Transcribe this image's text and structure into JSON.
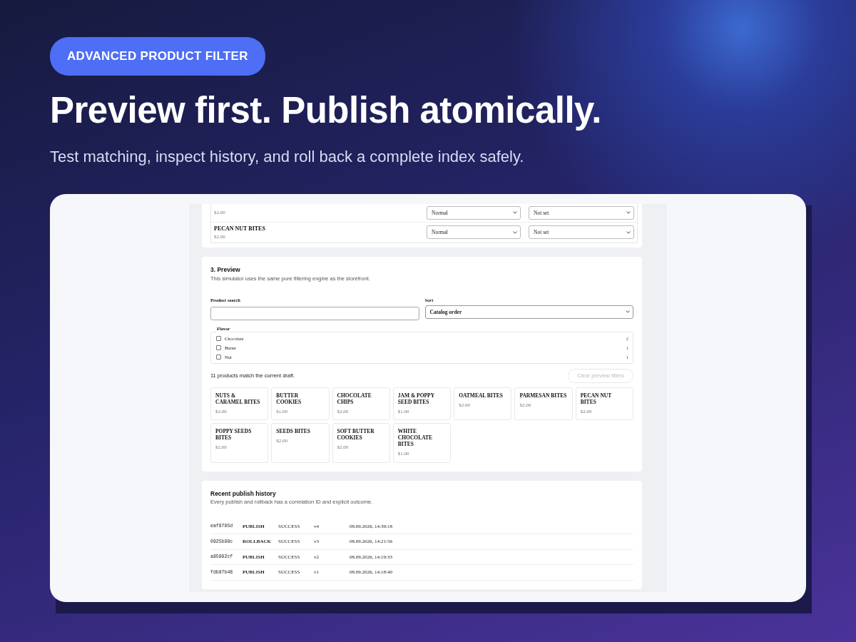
{
  "badge": "ADVANCED PRODUCT FILTER",
  "headline": "Preview first. Publish atomically.",
  "subtitle": "Test matching, inspect history, and roll back a complete index safely.",
  "rules_table": {
    "rows": [
      {
        "price": "$2.00",
        "match": "Normal",
        "boost": "Not set"
      },
      {
        "name": "PECAN NUT BITES",
        "price": "$2.00",
        "match": "Normal",
        "boost": "Not set"
      }
    ]
  },
  "preview": {
    "title": "3. Preview",
    "description": "This simulator uses the same pure filtering engine as the storefront.",
    "search": {
      "label": "Product search"
    },
    "sort": {
      "label": "Sort",
      "value": "Catalog order"
    },
    "flavor": {
      "legend": "Flavor",
      "options": [
        {
          "label": "Chocolate",
          "count": "2",
          "checked": false
        },
        {
          "label": "Butter",
          "count": "1",
          "checked": false
        },
        {
          "label": "Nut",
          "count": "1",
          "checked": false
        }
      ]
    },
    "summary": "11 products match the current draft.",
    "clear_button": {
      "label": "Clear preview filters",
      "disabled": true
    },
    "products": [
      {
        "name": "NUTS & CARAMEL BITES",
        "price": "$2.00"
      },
      {
        "name": "BUTTER COOKIES",
        "price": "$1.00"
      },
      {
        "name": "CHOCOLATE CHIPS",
        "price": "$2.00"
      },
      {
        "name": "JAM & POPPY SEED BITES",
        "price": "$1.00"
      },
      {
        "name": "OATMEAL BITES",
        "price": "$2.00"
      },
      {
        "name": "PARMESAN BITES",
        "price": "$2.00"
      },
      {
        "name": "PECAN NUT BITES",
        "price": "$2.00"
      },
      {
        "name": "POPPY SEEDS BITES",
        "price": "$2.00"
      },
      {
        "name": "SEEDS BITES",
        "price": "$2.00"
      },
      {
        "name": "SOFT BUTTER COOKIES",
        "price": "$2.00"
      },
      {
        "name": "WHITE CHOCOLATE BITES",
        "price": "$1.00"
      }
    ]
  },
  "history": {
    "title": "Recent publish history",
    "description": "Every publish and rollback has a correlation ID and explicit outcome.",
    "rows": [
      {
        "id": "eaf8785d",
        "action": "PUBLISH",
        "status": "SUCCESS",
        "version": "v4",
        "time": "08.09.2026, 14:39:18"
      },
      {
        "id": "0925b98c",
        "action": "ROLLBACK",
        "status": "SUCCESS",
        "version": "v3",
        "time": "08.09.2026, 14:21:56"
      },
      {
        "id": "a85992cf",
        "action": "PUBLISH",
        "status": "SUCCESS",
        "version": "v2",
        "time": "08.09.2026, 14:19:33"
      },
      {
        "id": "fdb87b48",
        "action": "PUBLISH",
        "status": "SUCCESS",
        "version": "v1",
        "time": "08.09.2026, 14:18:40"
      }
    ]
  }
}
